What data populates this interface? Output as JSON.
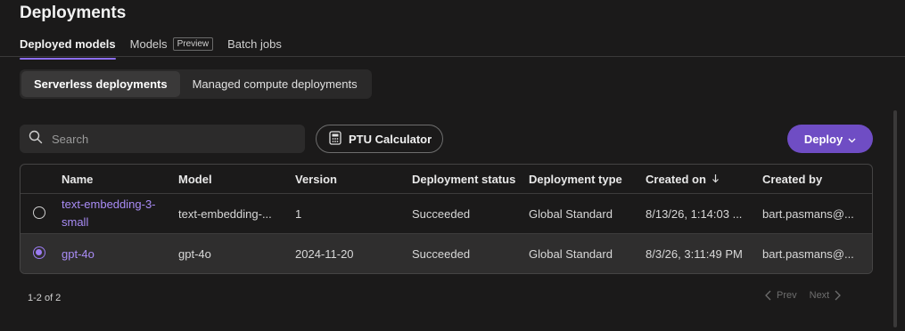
{
  "page": {
    "title": "Deployments"
  },
  "tabs": [
    {
      "label": "Deployed models",
      "active": true
    },
    {
      "label": "Models",
      "badge": "Preview"
    },
    {
      "label": "Batch jobs"
    }
  ],
  "segments": [
    {
      "label": "Serverless deployments",
      "active": true
    },
    {
      "label": "Managed compute deployments"
    }
  ],
  "search": {
    "placeholder": "Search",
    "icon": "search-icon"
  },
  "ptu_button": {
    "label": "PTU Calculator",
    "icon": "calculator-icon"
  },
  "deploy_button": {
    "label": "Deploy",
    "icon": "chevron-down-icon",
    "color": "#6f4dc4"
  },
  "table": {
    "columns": [
      "Name",
      "Model",
      "Version",
      "Deployment status",
      "Deployment type",
      "Created on",
      "Created by"
    ],
    "sort_icon": "arrow-down-icon",
    "rows": [
      {
        "selected": false,
        "name": "text-embedding-3-small",
        "model": "text-embedding-...",
        "version": "1",
        "status": "Succeeded",
        "type": "Global Standard",
        "created_on": "8/13/26, 1:14:03 ...",
        "created_by": "bart.pasmans@..."
      },
      {
        "selected": true,
        "name": "gpt-4o",
        "model": "gpt-4o",
        "version": "2024-11-20",
        "status": "Succeeded",
        "type": "Global Standard",
        "created_on": "8/3/26, 3:11:49 PM",
        "created_by": "bart.pasmans@..."
      }
    ]
  },
  "pagination": {
    "range": "1-2 of 2",
    "prev": "Prev",
    "next": "Next"
  },
  "colors": {
    "accent": "#8d6ef0",
    "link": "#a98cf6",
    "background": "#1b1a1a"
  }
}
